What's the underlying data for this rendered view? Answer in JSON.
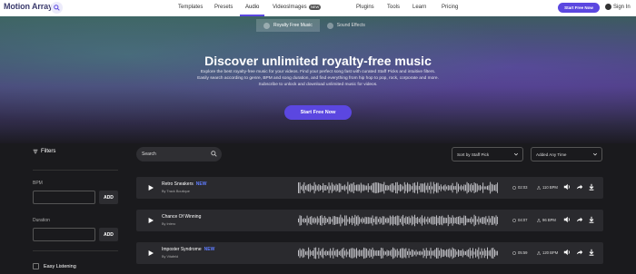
{
  "nav": {
    "logo": "Motion Array",
    "items": [
      "Templates",
      "Presets",
      "Audio",
      "Videos",
      "Images",
      "Plugins",
      "Tools",
      "Learn",
      "Pricing"
    ],
    "images_badge": "NEW",
    "start_button": "Start Free Now",
    "sign_in": "Sign In",
    "active": "Audio"
  },
  "subtabs": [
    "Royalty Free Music",
    "Sound Effects"
  ],
  "hero": {
    "title": "Discover unlimited royalty-free music",
    "description_lines": [
      "Explore the best royalty-free music for your videos. Find your perfect song fast with curated Staff Picks and intuitive filters.",
      "Easily search according to genre, BPM and song duration, and find everything from hip hop to pop, rock, corporate and more.",
      "Subscribe to unlock and download unlimited music for videos."
    ],
    "cta": "Start Free Now"
  },
  "filters": {
    "title": "Filters",
    "bpm_label": "BPM",
    "duration_label": "Duration",
    "add_label": "ADD",
    "checkbox_label": "Easy Listening"
  },
  "search": {
    "placeholder": "Search"
  },
  "sort": {
    "selected": "Sort by Staff Pick"
  },
  "date_filter": {
    "selected": "Added Any Time"
  },
  "tracks": [
    {
      "name": "Retro Sneakers",
      "new": "NEW",
      "by": "By Track Boutique",
      "duration": "02:03",
      "bpm": "110 BPM"
    },
    {
      "name": "Chance Of Winning",
      "new": "",
      "by": "By Intero",
      "duration": "04:07",
      "bpm": "96 BPM"
    },
    {
      "name": "Imposter Syndrome",
      "new": "NEW",
      "by": "By Vitafeld",
      "duration": "05:59",
      "bpm": "120 BPM"
    }
  ],
  "colors": {
    "accent": "#5b47e0",
    "new_badge": "#5f7cff"
  },
  "icons": [
    "search-icon",
    "filter-icon",
    "play-icon",
    "clock-icon",
    "metronome-icon",
    "volume-icon",
    "share-icon",
    "download-icon",
    "chevron-down-icon",
    "user-icon"
  ]
}
